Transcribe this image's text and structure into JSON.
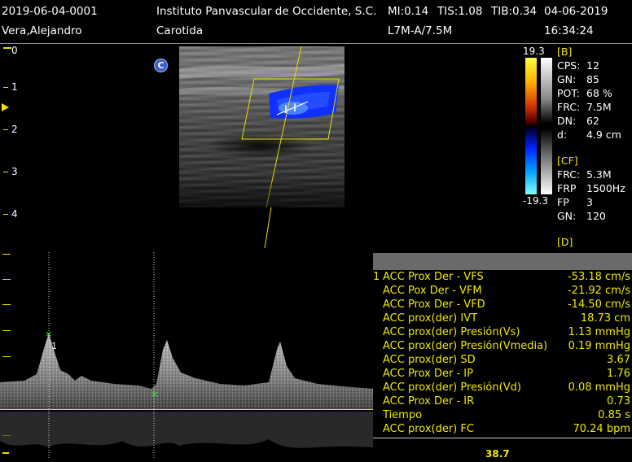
{
  "header": {
    "study_id": "2019-06-04-0001",
    "institution": "Instituto Panvascular de Occidente, S.C.",
    "mi": "MI:0.14",
    "tis": "TIS:1.08",
    "tib": "TIB:0.34",
    "date": "04-06-2019",
    "patient_name": "Vera,Alejandro",
    "exam": "Carotida",
    "probe": "L7M-A/7.5M",
    "time": "16:34:24"
  },
  "depth_scale": [
    "0",
    "1",
    "2",
    "3",
    "4"
  ],
  "mode_icon": {
    "label": "C",
    "color": "#3a5fc8"
  },
  "color_bar": {
    "max": "19.3",
    "min": "-19.3"
  },
  "b_params": {
    "title": "[B]",
    "rows": [
      {
        "key": "CPS:",
        "value": "12"
      },
      {
        "key": "GN:",
        "value": "85"
      },
      {
        "key": "POT:",
        "value": "68 %"
      },
      {
        "key": "FRC:",
        "value": "7.5M"
      },
      {
        "key": "DN:",
        "value": "62"
      },
      {
        "key": "d:",
        "value": "4.9 cm"
      }
    ]
  },
  "cf_params": {
    "title": "[CF]",
    "rows": [
      {
        "key": "FRC:",
        "value": "5.3M"
      },
      {
        "key": "FRP",
        "value": "1500Hz"
      },
      {
        "key": "FP",
        "value": "3"
      },
      {
        "key": "GN:",
        "value": "120"
      }
    ]
  },
  "d_params": {
    "title": "[D]"
  },
  "spectrum": {
    "cursor_marker": "1",
    "speed": "38.7"
  },
  "measurements": {
    "rows": [
      {
        "index": "1",
        "label": "ACC Prox Der - VFS",
        "value": "-53.18 cm/s"
      },
      {
        "index": "",
        "label": "ACC Pox Der - VFM",
        "value": "-21.92 cm/s"
      },
      {
        "index": "",
        "label": "ACC Prox Der - VFD",
        "value": "-14.50 cm/s"
      },
      {
        "index": "",
        "label": "ACC prox(der) IVT",
        "value": "18.73 cm"
      },
      {
        "index": "",
        "label": "ACC prox(der) Presión(Vs)",
        "value": "1.13 mmHg"
      },
      {
        "index": "",
        "label": "ACC prox(der) Presión(Vmedia)",
        "value": "0.19 mmHg"
      },
      {
        "index": "",
        "label": "ACC prox(der) SD",
        "value": "3.67"
      },
      {
        "index": "",
        "label": "ACC Prox Der - IP",
        "value": "1.76"
      },
      {
        "index": "",
        "label": "ACC prox(der) Presión(Vd)",
        "value": "0.08 mmHg"
      },
      {
        "index": "",
        "label": "ACC Prox Der - IR",
        "value": "0.73"
      },
      {
        "index": "",
        "label": "Tiempo",
        "value": "0.85 s"
      },
      {
        "index": "",
        "label": "ACC prox(der) FC",
        "value": "70.24 bpm"
      }
    ]
  },
  "colors": {
    "accent_yellow": "#f0e800",
    "text_white": "#ffffff",
    "table_header_gray": "#6a6a6a",
    "flow_blue": "#1030ff"
  }
}
